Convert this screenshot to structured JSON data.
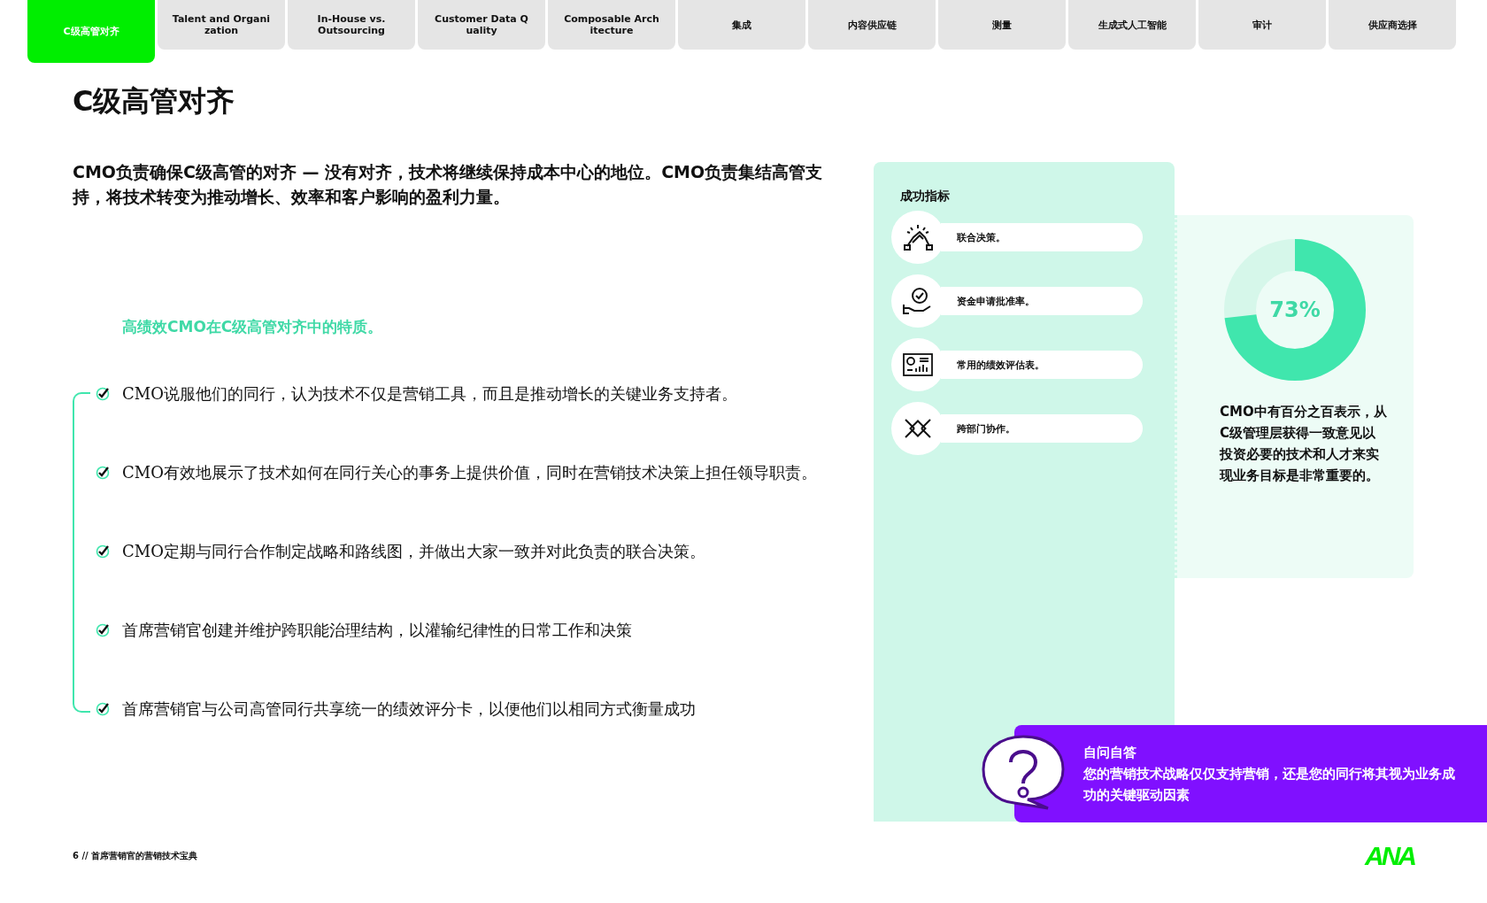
{
  "tabs": [
    {
      "label": "C级高管对齐",
      "selected": true
    },
    {
      "label": "Talent and Organi zation",
      "selected": false
    },
    {
      "label": "In-House vs. Outsourcing",
      "selected": false
    },
    {
      "label": "Customer Data Q uality",
      "selected": false
    },
    {
      "label": "Composable Arch itecture",
      "selected": false
    },
    {
      "label": "集成",
      "selected": false
    },
    {
      "label": "内容供应链",
      "selected": false
    },
    {
      "label": "测量",
      "selected": false
    },
    {
      "label": "生成式人工智能",
      "selected": false
    },
    {
      "label": "审计",
      "selected": false
    },
    {
      "label": "供应商选择",
      "selected": false
    }
  ],
  "title": "C级高管对齐",
  "intro": "CMO负责确保C级高管的对齐 — 没有对齐，技术将继续保持成本中心的地位。CMO负责集结高管支持，将技术转变为推动增长、效率和客户影响的盈利力量。",
  "traits_heading": "高绩效CMO在C级高管对齐中的特质。",
  "traits": [
    {
      "text": "CMO说服他们的同行，认为技术不仅是营销工具，而且是推动增长的关键业务支持者。",
      "checked": true
    },
    {
      "text": "CMO有效地展示了技术如何在同行关心的事务上提供价值，同时在营销技术决策上担任领导职责。",
      "checked": true
    },
    {
      "text": "CMO定期与同行合作制定战略和路线图，并做出大家一致并对此负责的联合决策。",
      "checked": true
    },
    {
      "text": "首席营销官创建并维护跨职能治理结构，以灌输纪律性的日常工作和决策",
      "checked": true
    },
    {
      "text": "首席营销官与公司高管同行共享统一的绩效评分卡，以便他们以相同方式衡量成功",
      "checked": true
    }
  ],
  "metrics": {
    "heading": "成功指标",
    "items": [
      {
        "kind": "handshake",
        "label": "联合决策。"
      },
      {
        "kind": "hand-gear",
        "label": "资金申请批准率。"
      },
      {
        "kind": "dashboard",
        "label": "常用的绩效评估表。"
      },
      {
        "kind": "hands",
        "label": "跨部门协作。"
      }
    ]
  },
  "stat": {
    "level": 0.73,
    "label": "73%",
    "text": "CMO中有百分之百表示，从C级管理层获得一致意见以投资必要的技术和人才来实现业务目标是非常重要的。"
  },
  "callout": {
    "title": "自问自答",
    "text": "您的营销技术战略仅仅支持营销，还是您的同行将其视为业务成功的关键驱动因素"
  },
  "footer": "6 // 首席营销官的营销技术宝典",
  "logo": "ANA"
}
